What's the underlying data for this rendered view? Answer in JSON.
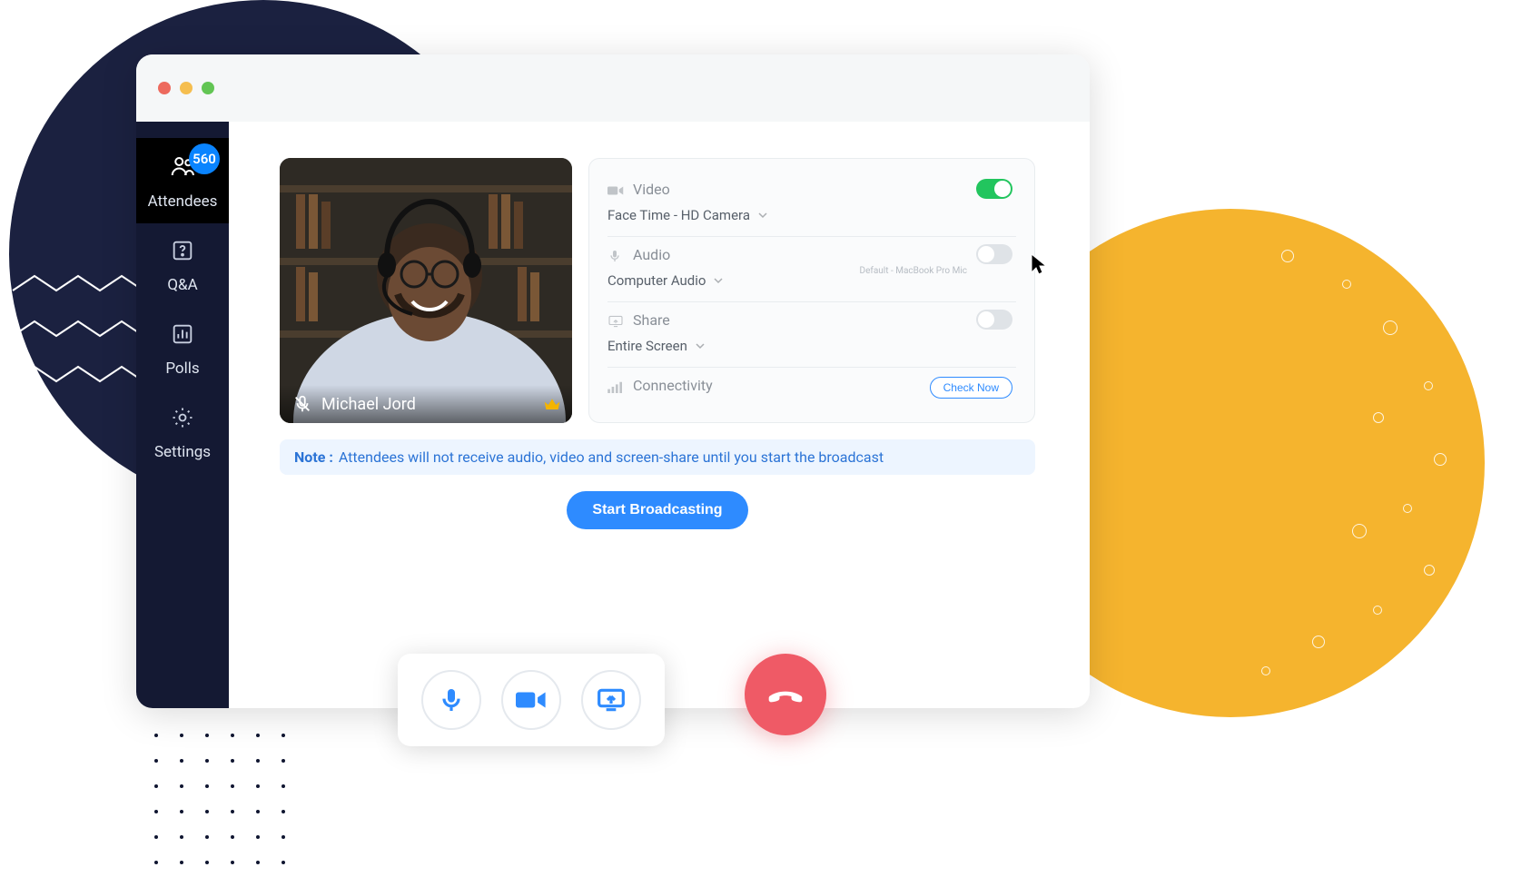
{
  "sidebar": {
    "items": [
      {
        "label": "Attendees",
        "icon": "people-icon",
        "badge": "560"
      },
      {
        "label": "Q&A",
        "icon": "question-icon"
      },
      {
        "label": "Polls",
        "icon": "poll-icon"
      },
      {
        "label": "Settings",
        "icon": "gear-icon"
      }
    ]
  },
  "video_tile": {
    "presenter_name": "Michael Jord",
    "mic_muted": true,
    "role_icon": "crown-icon"
  },
  "settings": {
    "video": {
      "label": "Video",
      "source": "Face Time - HD Camera",
      "enabled": true
    },
    "audio": {
      "label": "Audio",
      "source": "Computer Audio",
      "device_hint": "Default - MacBook Pro Mic",
      "enabled": false
    },
    "share": {
      "label": "Share",
      "source": "Entire Screen",
      "enabled": false
    },
    "connectivity": {
      "label": "Connectivity",
      "action": "Check Now"
    }
  },
  "note": {
    "prefix": "Note :",
    "text": "Attendees will not receive audio, video and screen-share until you start the broadcast"
  },
  "primary_action": "Start Broadcasting",
  "controls": {
    "mic": "microphone-icon",
    "cam": "camera-icon",
    "screen": "screenshare-icon",
    "hangup": "hangup-icon"
  },
  "colors": {
    "accent": "#2e8bff",
    "success": "#22c55e",
    "danger": "#ef5a66",
    "navy": "#141933",
    "mustard": "#f5b42e"
  }
}
